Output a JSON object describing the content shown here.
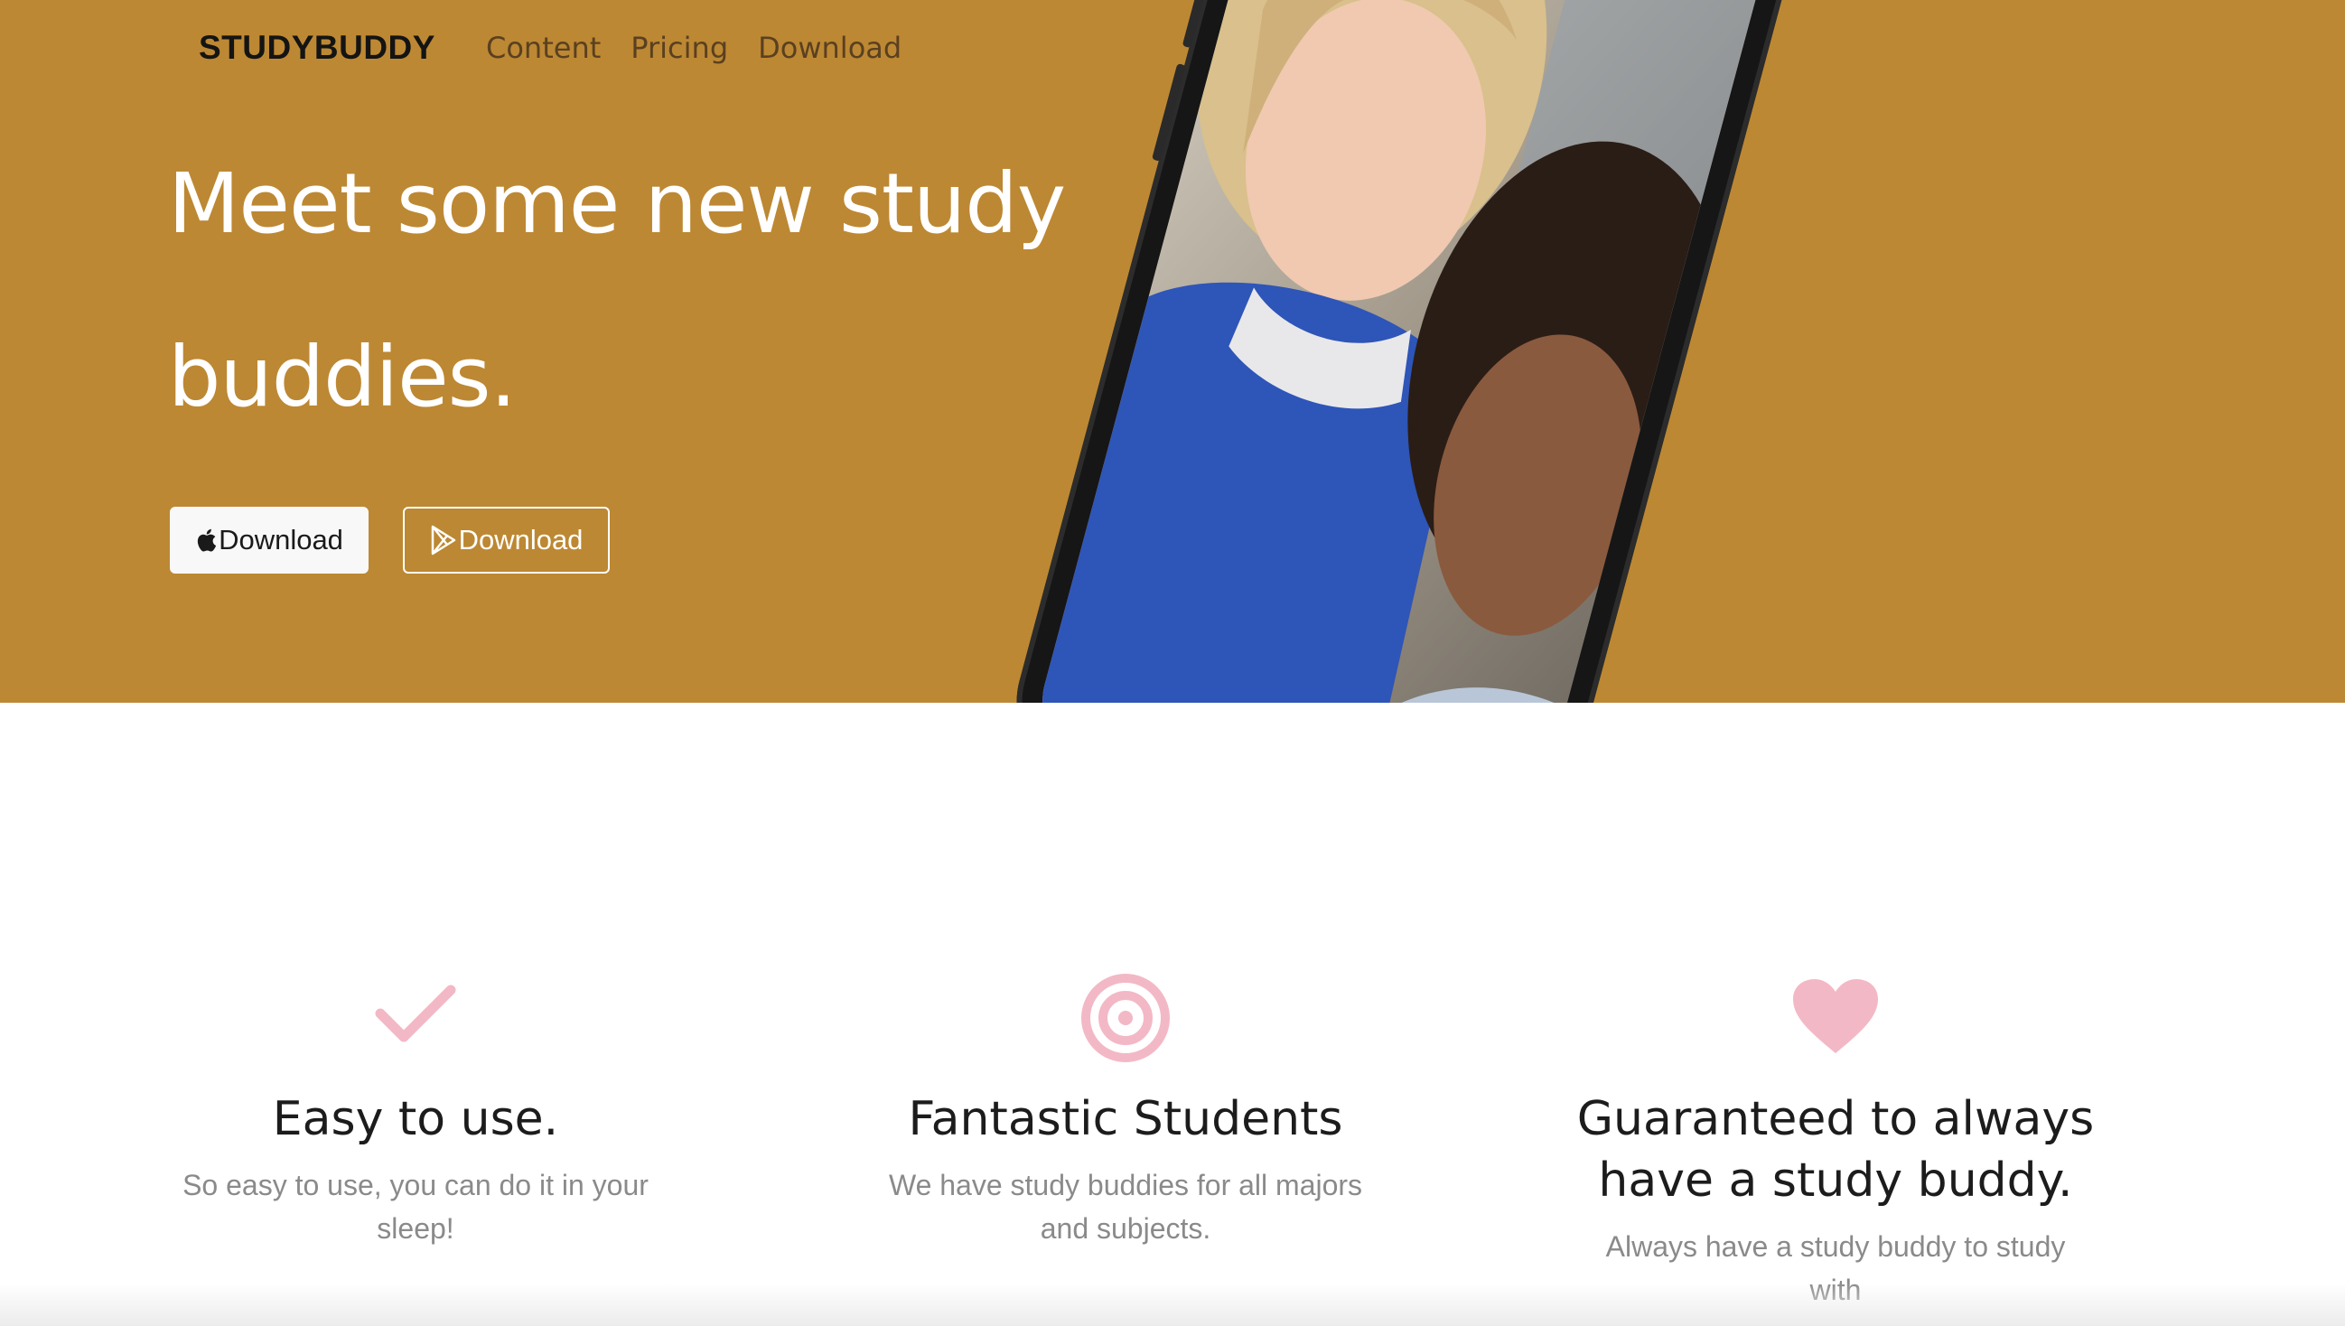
{
  "nav": {
    "brand": "STUDYBUDDY",
    "links": [
      "Content",
      "Pricing",
      "Download"
    ]
  },
  "hero": {
    "title_line1": "Meet some new study",
    "title_line2": "buddies.",
    "buttons": {
      "apple_label": "Download",
      "apple_icon": "apple-icon",
      "play_label": "Download",
      "play_icon": "google-play-icon"
    },
    "image": "phone-mockup-two-students",
    "background_color": "#bd8833"
  },
  "features": [
    {
      "icon": "check-icon",
      "title_lines": [
        "Easy to use."
      ],
      "desc_lines": [
        "So easy to use, you can do it in your",
        "sleep!"
      ]
    },
    {
      "icon": "target-icon",
      "title_lines": [
        "Fantastic Students"
      ],
      "desc_lines": [
        "We have study buddies for all majors",
        "and subjects."
      ]
    },
    {
      "icon": "heart-icon",
      "title_lines": [
        "Guaranteed to always",
        "have a study buddy."
      ],
      "desc_lines": [
        "Always have a study buddy to study",
        "with"
      ]
    }
  ],
  "colors": {
    "accent_icon": "#f3b8c6",
    "title_text": "#1c1c1c",
    "desc_text": "#8a8a8a"
  }
}
